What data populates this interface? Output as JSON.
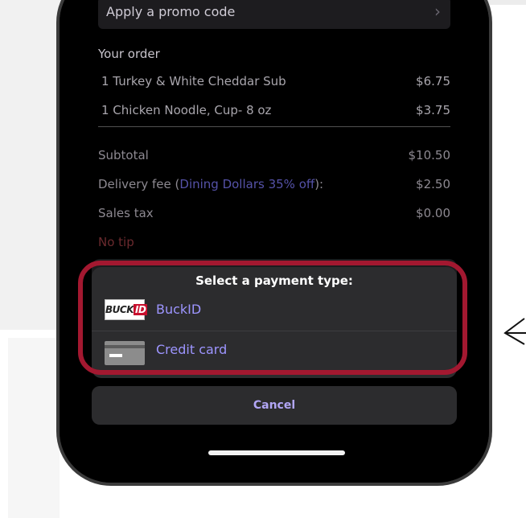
{
  "promo": {
    "label": "Apply a promo code"
  },
  "order": {
    "title": "Your order",
    "items": [
      {
        "name": "1 Turkey & White Cheddar Sub",
        "price": "$6.75"
      },
      {
        "name": "1 Chicken Noodle, Cup- 8 oz",
        "price": "$3.75"
      }
    ]
  },
  "summary": {
    "subtotal_label": "Subtotal",
    "subtotal_value": "$10.50",
    "delivery_prefix": "Delivery fee (",
    "delivery_discount": "Dining Dollars 35% off",
    "delivery_suffix": "):",
    "delivery_value": "$2.50",
    "tax_label": "Sales tax",
    "tax_value": "$0.00",
    "tip_label": "No tip"
  },
  "payment_sheet": {
    "title": "Select a payment type:",
    "options": [
      {
        "label": "BuckID",
        "icon": "buckid-logo-icon",
        "logo_text": "BUCK",
        "logo_accent": "ID"
      },
      {
        "label": "Credit card",
        "icon": "credit-card-icon"
      }
    ],
    "cancel_label": "Cancel"
  },
  "colors": {
    "annotation": "#a31830",
    "accent": "#9d95ff",
    "discount_link": "#5552a8",
    "no_tip": "#6b2a2e"
  }
}
